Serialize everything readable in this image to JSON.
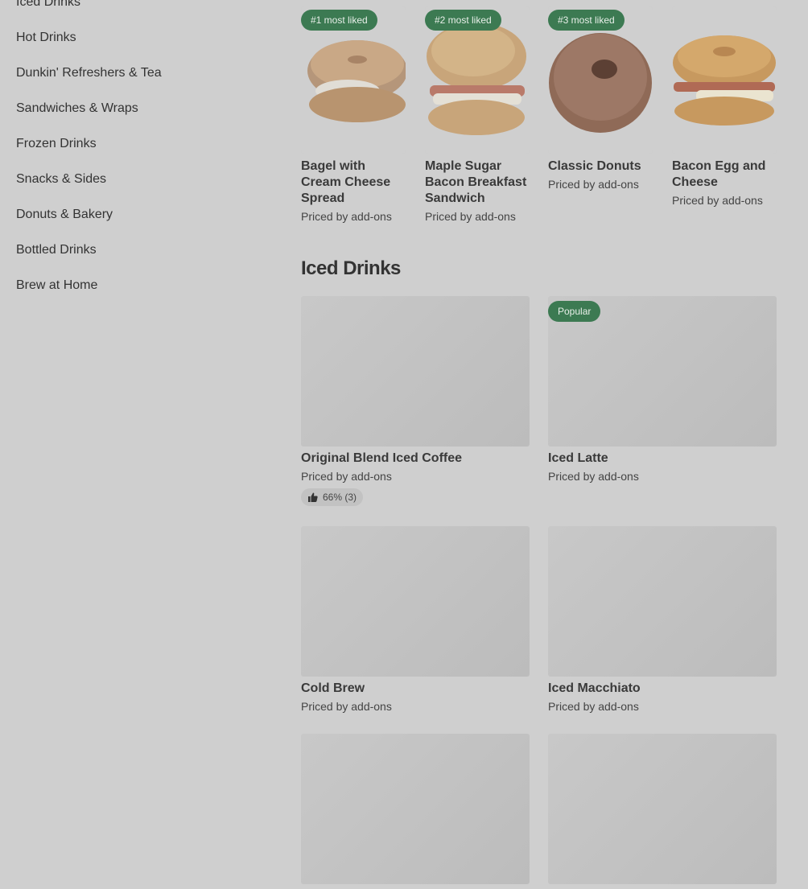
{
  "sidebar": {
    "items": [
      {
        "label": "Iced Drinks"
      },
      {
        "label": "Hot Drinks"
      },
      {
        "label": "Dunkin' Refreshers & Tea"
      },
      {
        "label": "Sandwiches & Wraps"
      },
      {
        "label": "Frozen Drinks"
      },
      {
        "label": "Snacks & Sides"
      },
      {
        "label": "Donuts & Bakery"
      },
      {
        "label": "Bottled Drinks"
      },
      {
        "label": "Brew at Home"
      }
    ]
  },
  "most_liked": [
    {
      "badge": "#1 most liked",
      "title": "Bagel with Cream Cheese Spread",
      "price": "Priced by add-ons"
    },
    {
      "badge": "#2 most liked",
      "title": "Maple Sugar Bacon Breakfast Sandwich",
      "price": "Priced by add-ons"
    },
    {
      "badge": "#3 most liked",
      "title": "Classic Donuts",
      "price": "Priced by add-ons"
    },
    {
      "badge": "",
      "title": "Bacon Egg and Cheese",
      "price": "Priced by add-ons"
    }
  ],
  "section": {
    "title": "Iced Drinks"
  },
  "products": [
    {
      "title": "Original Blend Iced Coffee",
      "price": "Priced by add-ons",
      "rating": "66% (3)"
    },
    {
      "title": "Iced Latte",
      "price": "Priced by add-ons",
      "badge": "Popular"
    },
    {
      "title": "Cold Brew",
      "price": "Priced by add-ons"
    },
    {
      "title": "Iced Macchiato",
      "price": "Priced by add-ons"
    },
    {
      "title": "",
      "price": ""
    },
    {
      "title": "",
      "price": ""
    }
  ],
  "colors": {
    "badge_green": "#3c7a52",
    "background": "#cfcfcf"
  },
  "icons": {
    "rating": "thumbs-up-icon"
  }
}
